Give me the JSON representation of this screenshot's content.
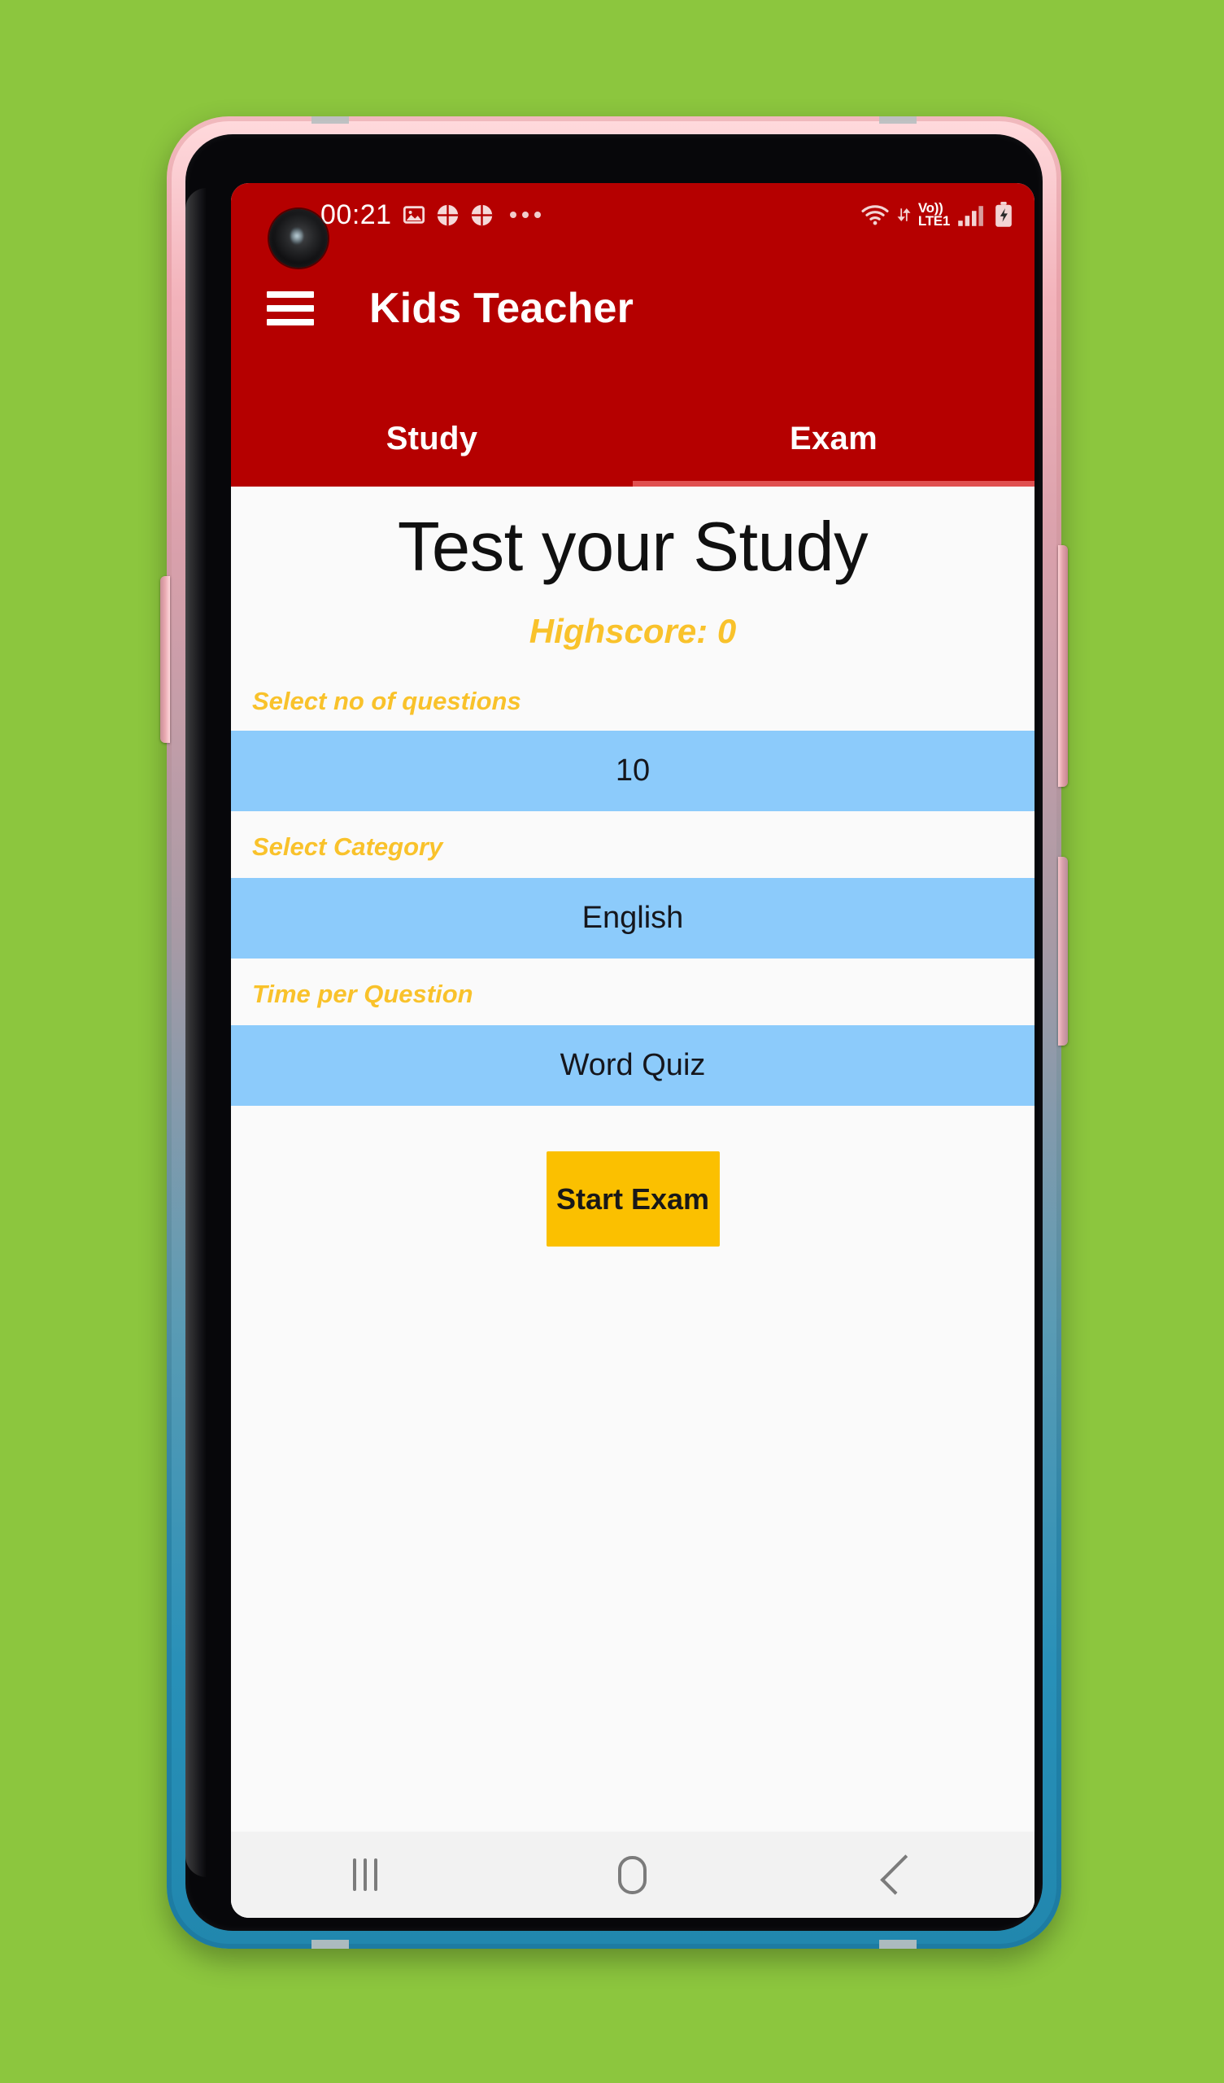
{
  "background": {
    "color": "#8cc63e"
  },
  "device": {
    "frame_top_color": "#e9a3ab",
    "frame_bottom_color": "#1e7fa6",
    "buttons": [
      {
        "name": "volume-left",
        "side": "left"
      },
      {
        "name": "volume-right",
        "side": "right"
      },
      {
        "name": "power",
        "side": "right"
      }
    ]
  },
  "statusbar": {
    "clock": "00:21",
    "left_icons": [
      "image-icon",
      "puzzle-icon",
      "puzzle-icon",
      "more-dots-icon"
    ],
    "right_icons": [
      "wifi-icon",
      "data-transfer-icon",
      "signal-bars-icon",
      "battery-charging-icon"
    ],
    "network_top": "Vo))",
    "network_bottom": "LTE1"
  },
  "appbar": {
    "color": "#b50000",
    "menu_icon": "hamburger-menu-icon",
    "title": "Kids Teacher"
  },
  "tabs": [
    {
      "label": "Study",
      "active": false
    },
    {
      "label": "Exam",
      "active": true
    }
  ],
  "main": {
    "headline": "Test your Study",
    "highscore": "Highscore: 0",
    "accent_color": "#f9c22b",
    "spinner_color": "#8ccbfb",
    "fields": [
      {
        "label": "Select no of questions",
        "value": "10"
      },
      {
        "label": "Select Category",
        "value": "English"
      },
      {
        "label": "Time per Question",
        "value": "Word Quiz"
      }
    ],
    "start_button": {
      "label": "Start Exam",
      "color": "#fbc000"
    }
  },
  "navbar": {
    "recents": "recents-icon",
    "home": "home-icon",
    "back": "back-icon"
  }
}
